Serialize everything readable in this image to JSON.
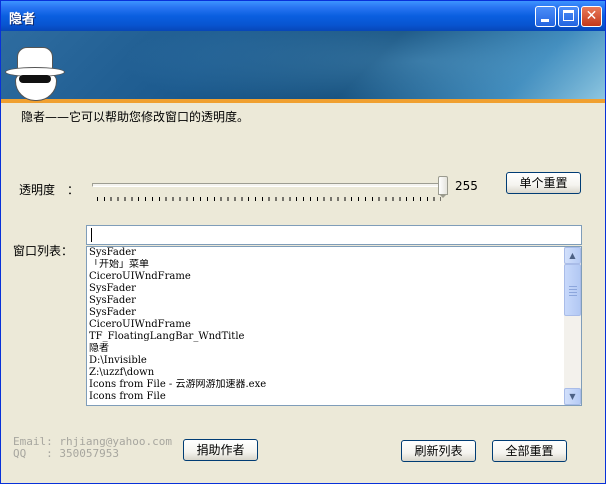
{
  "window": {
    "title": "隐者"
  },
  "header": {
    "description": "隐者——它可以帮助您修改窗口的透明度。"
  },
  "transparency": {
    "label": "透明度　：",
    "value": "255",
    "reset_single_label": "单个重置"
  },
  "window_list": {
    "label": "窗口列表：",
    "filter_value": "",
    "items": [
      "SysFader",
      "「开始」菜单",
      "CiceroUIWndFrame",
      "SysFader",
      "SysFader",
      "SysFader",
      "CiceroUIWndFrame",
      "TF_FloatingLangBar_WndTitle",
      "隐者",
      "D:\\Invisible",
      "Z:\\uzzf\\down",
      "Icons from File - 云游网游加速器.exe",
      "Icons from File"
    ]
  },
  "footer": {
    "email": "Email: rhjiang@yahoo.com",
    "qq": "QQ   : 350057953",
    "donate_label": "捐助作者",
    "refresh_label": "刷新列表",
    "reset_all_label": "全部重置"
  },
  "icons": [
    "minimize-icon",
    "maximize-icon",
    "close-icon",
    "spy-logo-icon",
    "scroll-up-icon",
    "scroll-down-icon"
  ]
}
